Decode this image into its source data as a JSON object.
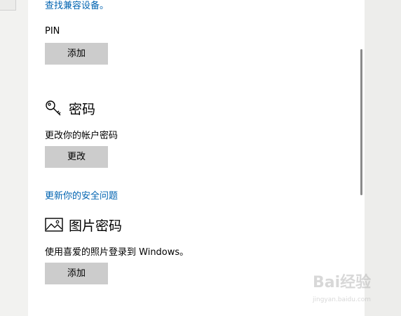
{
  "top_link": "查找兼容设备。",
  "pin": {
    "label": "PIN",
    "add_button": "添加"
  },
  "password": {
    "icon": "key-icon",
    "title": "密码",
    "description": "更改你的帐户密码",
    "change_button": "更改",
    "security_link": "更新你的安全问题"
  },
  "picture_password": {
    "icon": "picture-icon",
    "title": "图片密码",
    "description": "使用喜爱的照片登录到 Windows。",
    "add_button": "添加"
  },
  "watermark": {
    "brand": "Bai经验",
    "url": "jingyan.baidu.com"
  },
  "colors": {
    "link": "#0063b1",
    "button_bg": "#cccccc",
    "panel_bg": "#ffffff"
  }
}
